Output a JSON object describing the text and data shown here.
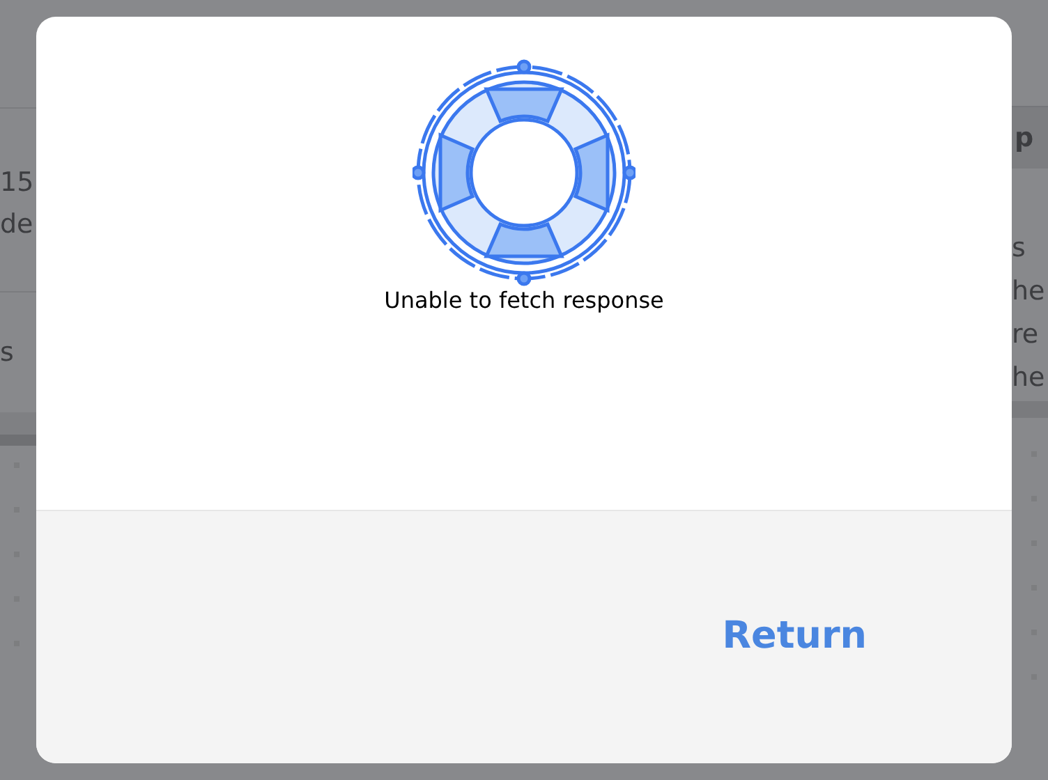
{
  "background": {
    "left_texts": [
      "15",
      "de",
      "s"
    ],
    "right_header": "p",
    "right_texts": [
      "s",
      "he",
      "re",
      "he"
    ]
  },
  "dialog": {
    "message": "Unable to fetch response",
    "buttons": [
      {
        "label": "Return",
        "kind": "link"
      }
    ]
  }
}
